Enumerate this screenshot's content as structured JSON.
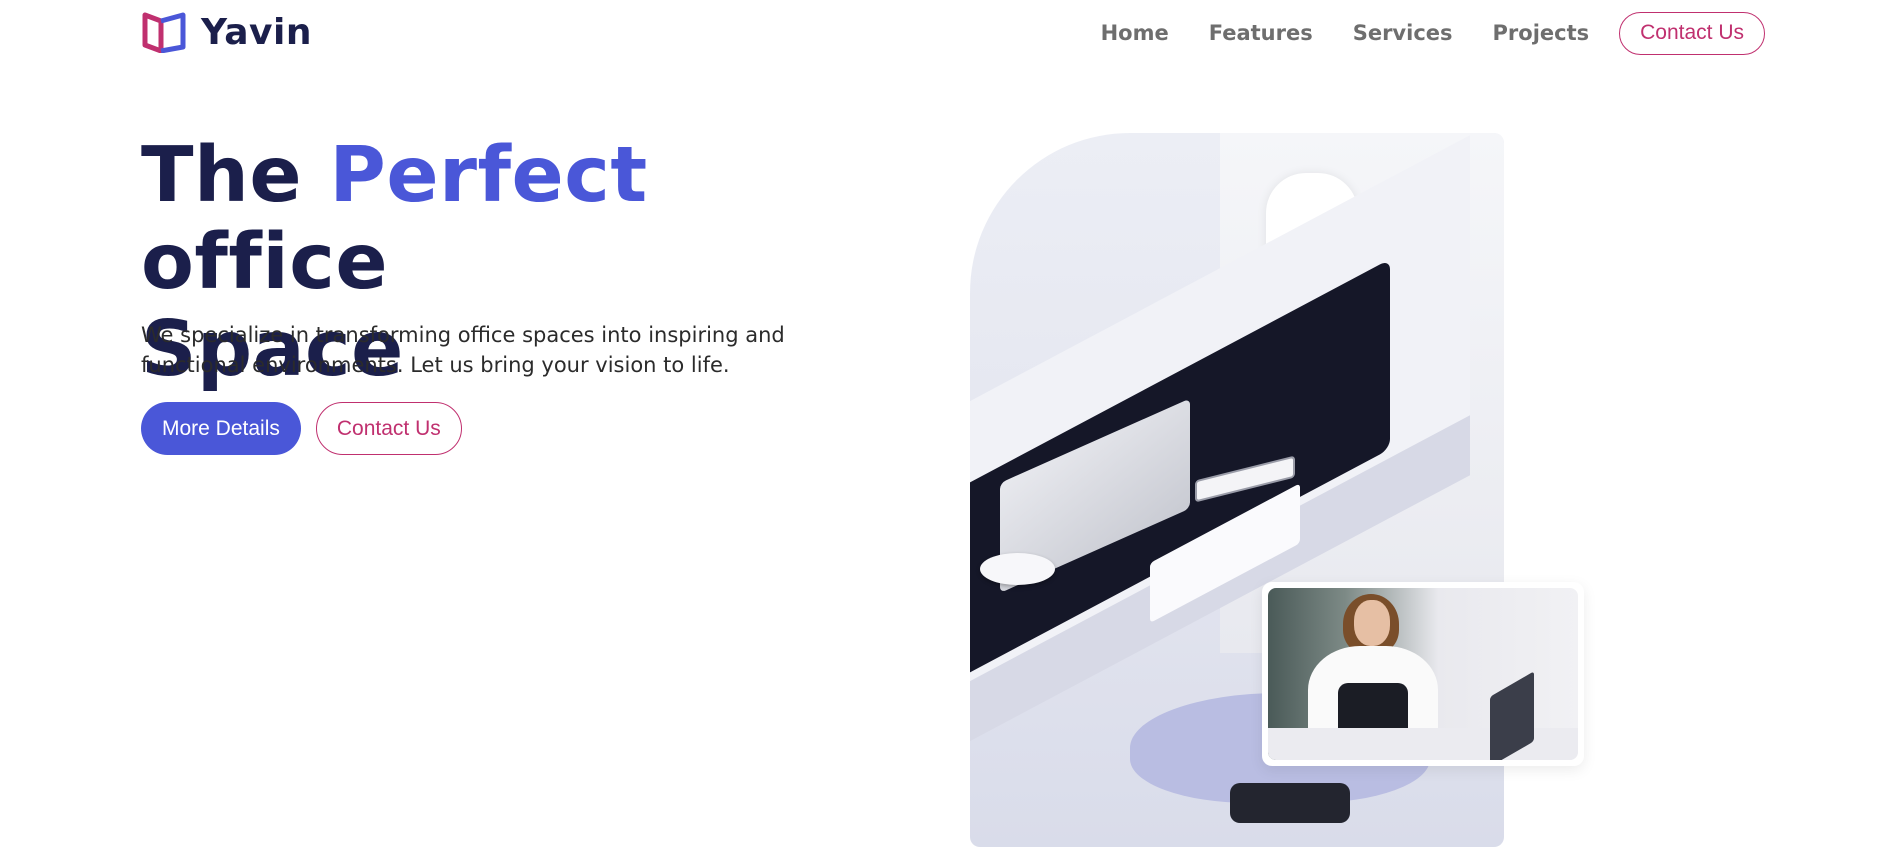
{
  "brand": {
    "name": "Yavin"
  },
  "nav": {
    "links": [
      "Home",
      "Features",
      "Services",
      "Projects"
    ],
    "contact_label": "Contact Us"
  },
  "hero": {
    "title_part1": "The",
    "title_accent": "Perfect",
    "title_part2": "office",
    "title_line2": "Space",
    "description": "We specialize in transforming office spaces into inspiring and functional environments. Let us bring your vision to life.",
    "primary_button": "More Details",
    "secondary_button": "Contact Us"
  },
  "colors": {
    "accent_blue": "#4a57d8",
    "accent_magenta": "#c0306f",
    "heading": "#1b1f4b"
  },
  "icons": {
    "logo": "book-logo-icon"
  }
}
